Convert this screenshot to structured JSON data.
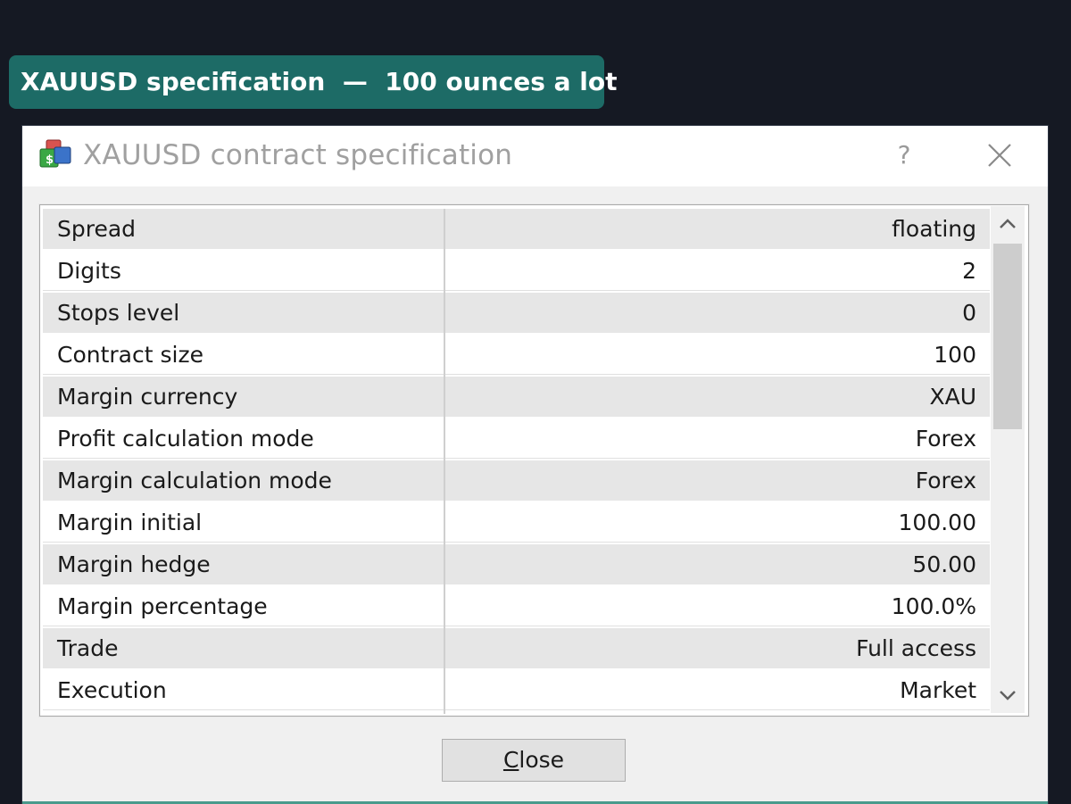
{
  "banner": {
    "text": "XAUUSD specification  —  100 ounces a lot"
  },
  "dialog": {
    "title": "XAUUSD contract specification",
    "help_label": "?",
    "close_button_mnemonic": "C",
    "close_button_rest": "lose"
  },
  "spec_rows": [
    {
      "name": "Spread",
      "value": "floating"
    },
    {
      "name": "Digits",
      "value": "2"
    },
    {
      "name": "Stops level",
      "value": "0"
    },
    {
      "name": "Contract size",
      "value": "100"
    },
    {
      "name": "Margin currency",
      "value": "XAU"
    },
    {
      "name": "Profit calculation mode",
      "value": "Forex"
    },
    {
      "name": "Margin calculation mode",
      "value": "Forex"
    },
    {
      "name": "Margin initial",
      "value": "100.00"
    },
    {
      "name": "Margin hedge",
      "value": "50.00"
    },
    {
      "name": "Margin percentage",
      "value": "100.0%"
    },
    {
      "name": "Trade",
      "value": "Full access"
    },
    {
      "name": "Execution",
      "value": "Market"
    }
  ],
  "icons": {
    "app": "symbol-spec-icon",
    "close": "close-icon",
    "scroll_up": "chevron-up-icon",
    "scroll_down": "chevron-down-icon"
  },
  "colors": {
    "banner_bg": "#1d6b66",
    "page_bg": "#151923",
    "row_shaded": "#e6e6e6"
  }
}
